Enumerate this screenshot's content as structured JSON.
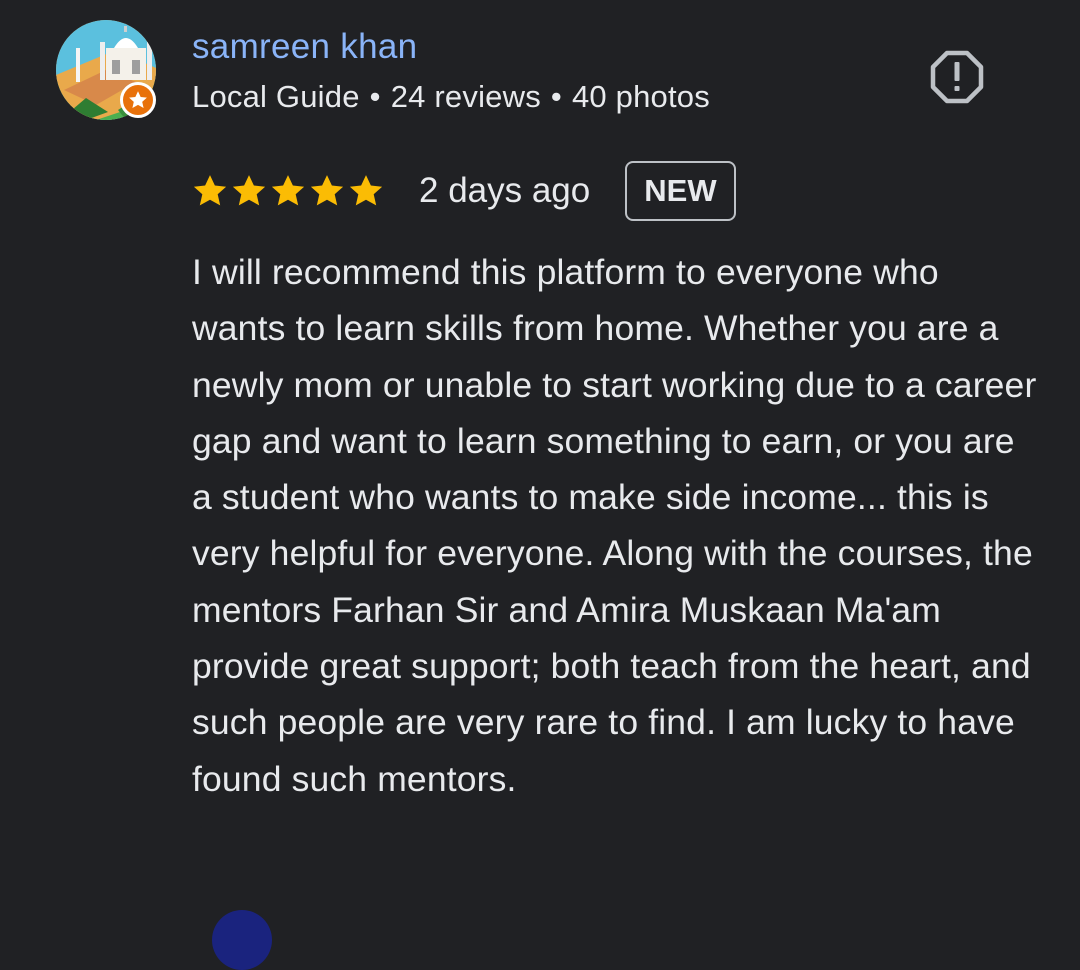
{
  "review": {
    "author": {
      "name": "samreen khan",
      "level": "Local Guide",
      "reviews": "24 reviews",
      "photos": "40 photos",
      "separator": "•",
      "avatar_icon": "profile-photo-taj-mahal",
      "badge_icon": "star-icon"
    },
    "rating": {
      "value": 5,
      "max": 5,
      "color": "#fbbc04"
    },
    "time_ago": "2 days ago",
    "badge": "NEW",
    "report_icon": "report-octagon-icon",
    "text": "I will recommend this platform to everyone who wants to learn skills from home. Whether you are a newly mom or unable to start working due to a career gap and want to learn something to earn, or you are a student who wants to make side income... this is very helpful for everyone. Along with the courses, the mentors Farhan Sir and Amira Muskaan Ma'am provide great support; both teach from the heart, and such people are very rare to find. I am lucky to have found such mentors."
  },
  "colors": {
    "background": "#202124",
    "name": "#8ab4f8",
    "text": "#e8eaed",
    "badge_orange": "#e8710a"
  }
}
